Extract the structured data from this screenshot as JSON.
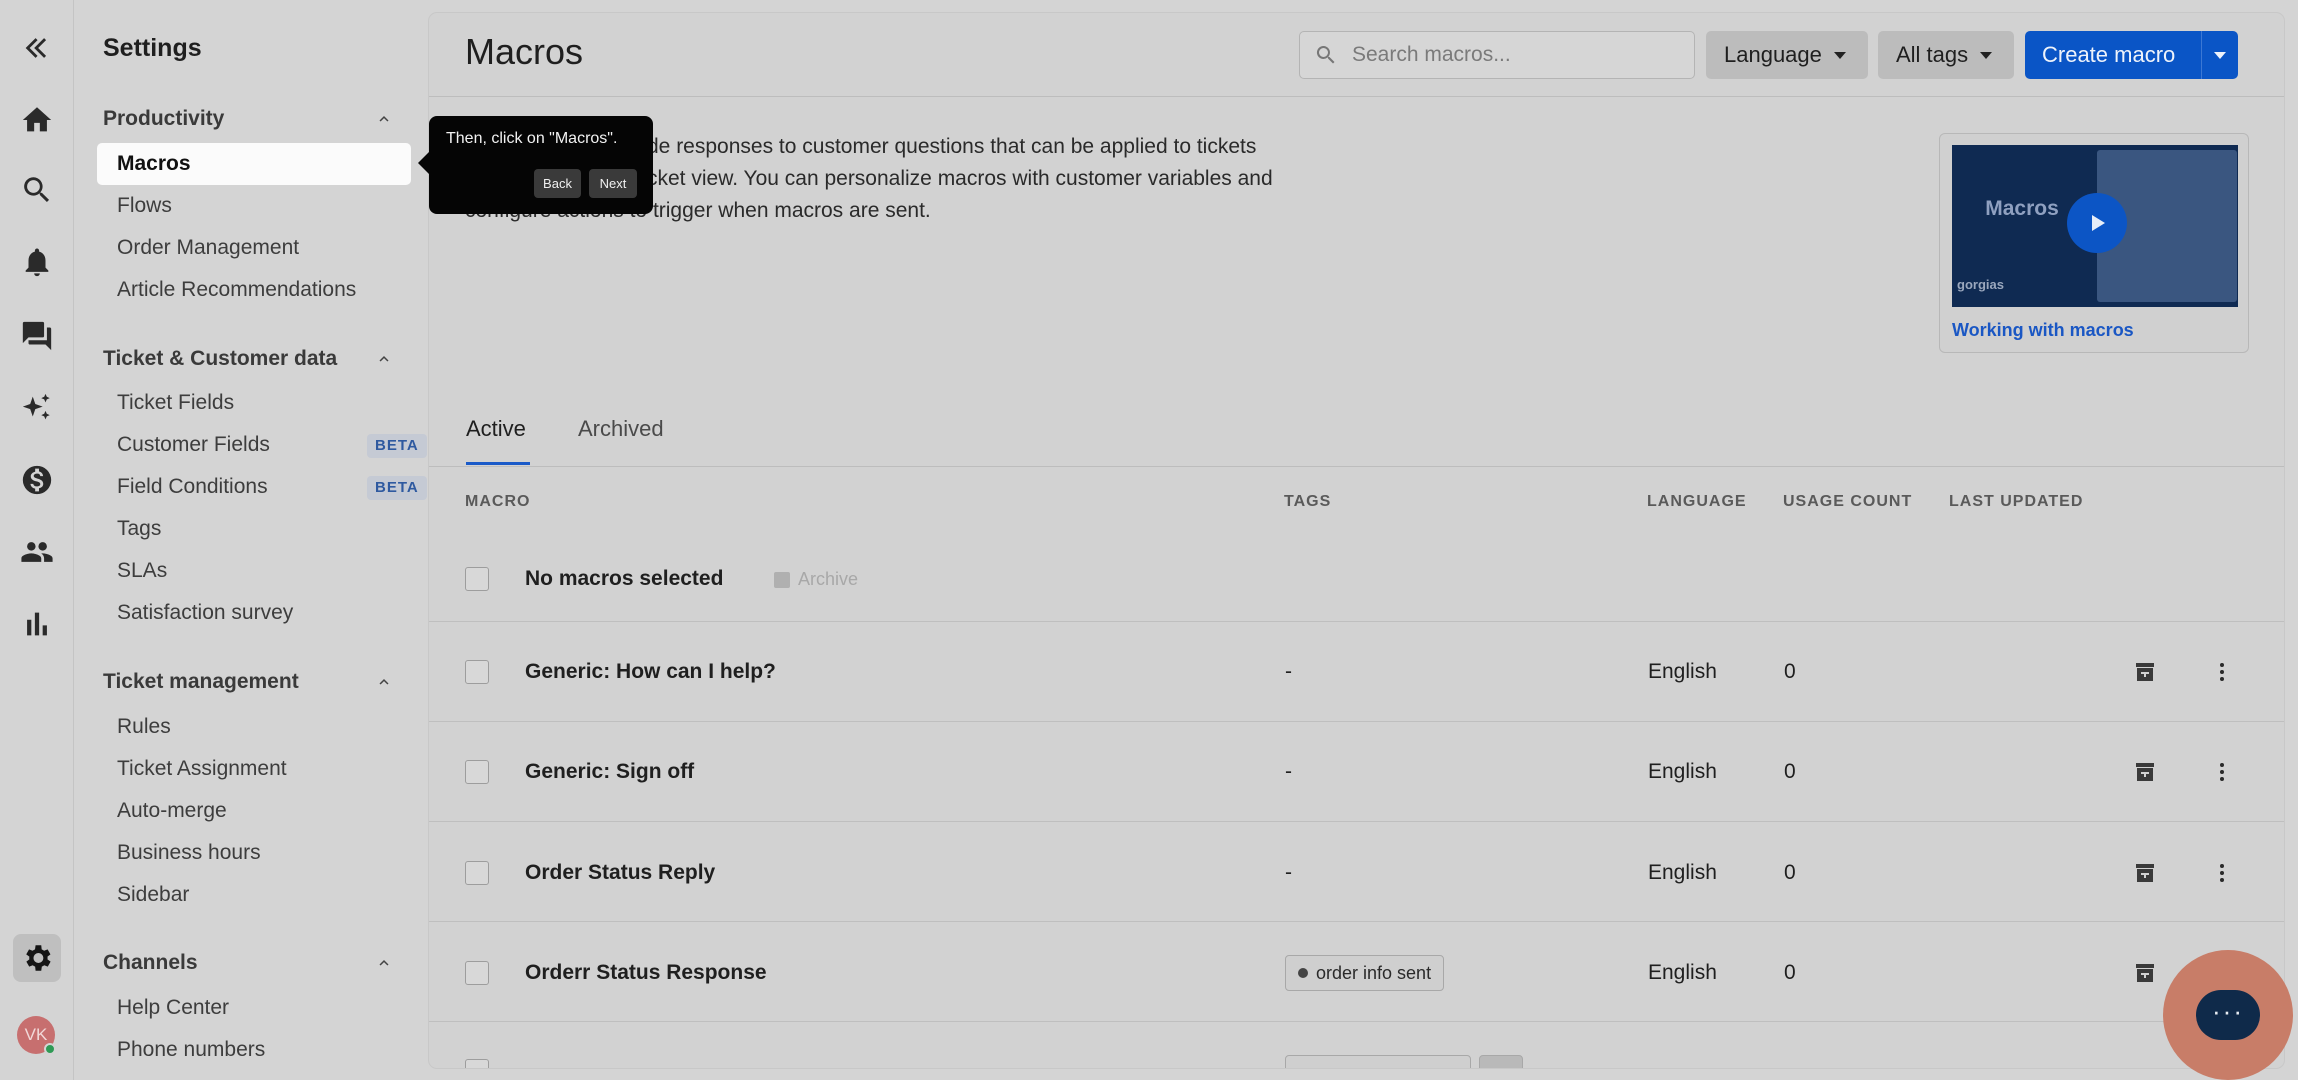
{
  "rail": {
    "collapse_icon": "chevrons-left-icon",
    "avatar_initials": "VK"
  },
  "sidebar": {
    "title": "Settings",
    "sections": [
      {
        "label": "Productivity",
        "items": [
          "Macros",
          "Flows",
          "Order Management",
          "Article Recommendations"
        ]
      },
      {
        "label": "Ticket & Customer data",
        "items": [
          "Ticket Fields",
          "Customer Fields",
          "Field Conditions",
          "Tags",
          "SLAs",
          "Satisfaction survey"
        ]
      },
      {
        "label": "Ticket management",
        "items": [
          "Rules",
          "Ticket Assignment",
          "Auto-merge",
          "Business hours",
          "Sidebar"
        ]
      },
      {
        "label": "Channels",
        "items": [
          "Help Center",
          "Phone numbers"
        ]
      }
    ],
    "beta": "BETA",
    "active_item": "Macros"
  },
  "header": {
    "title": "Macros",
    "search_placeholder": "Search macros...",
    "language_label": "Language",
    "tags_label": "All tags",
    "create_label": "Create macro"
  },
  "description": {
    "line1": "de responses to customer questions that can be applied to tickets",
    "line2": "cket view. You can personalize macros with customer variables and",
    "line3": "configure actions to trigger when macros are sent."
  },
  "video": {
    "thumb_title": "Macros",
    "thumb_brand": "gorgias",
    "link": "Working with macros"
  },
  "tabs": {
    "active": "Active",
    "archived": "Archived"
  },
  "table": {
    "headers": {
      "macro": "MACRO",
      "tags": "TAGS",
      "language": "LANGUAGE",
      "usage": "USAGE COUNT",
      "updated": "LAST UPDATED"
    },
    "selection_label": "No macros selected",
    "archive_label": "Archive",
    "rows": [
      {
        "name": "Generic: How can I help?",
        "tags": "-",
        "language": "English",
        "usage": "0"
      },
      {
        "name": "Generic: Sign off",
        "tags": "-",
        "language": "English",
        "usage": "0"
      },
      {
        "name": "Order Status Reply",
        "tags": "-",
        "language": "English",
        "usage": "0"
      },
      {
        "name": "Orderr Status Response",
        "tags": "order info sent",
        "language": "English",
        "usage": "0"
      }
    ]
  },
  "tooltip": {
    "text": "Then, click on \"Macros\".",
    "back": "Back",
    "next": "Next"
  }
}
